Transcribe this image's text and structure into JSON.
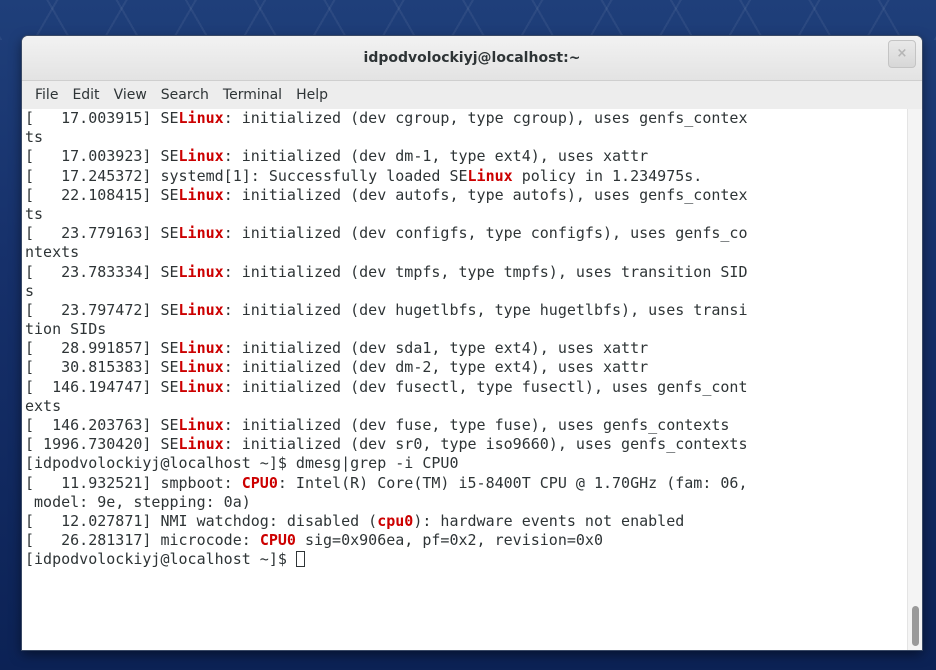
{
  "window": {
    "title": "idpodvolockiyj@localhost:~",
    "close_label": "×"
  },
  "menu": [
    "File",
    "Edit",
    "View",
    "Search",
    "Terminal",
    "Help"
  ],
  "terminal": {
    "lines": [
      [
        {
          "t": "[   17.003915] SE"
        },
        {
          "t": "Linux",
          "hl": true
        },
        {
          "t": ": initialized (dev cgroup, type cgroup), uses genfs_contex"
        }
      ],
      [
        {
          "t": "ts"
        }
      ],
      [
        {
          "t": "[   17.003923] SE"
        },
        {
          "t": "Linux",
          "hl": true
        },
        {
          "t": ": initialized (dev dm-1, type ext4), uses xattr"
        }
      ],
      [
        {
          "t": "[   17.245372] systemd[1]: Successfully loaded SE"
        },
        {
          "t": "Linux",
          "hl": true
        },
        {
          "t": " policy in 1.234975s."
        }
      ],
      [
        {
          "t": "[   22.108415] SE"
        },
        {
          "t": "Linux",
          "hl": true
        },
        {
          "t": ": initialized (dev autofs, type autofs), uses genfs_contex"
        }
      ],
      [
        {
          "t": "ts"
        }
      ],
      [
        {
          "t": "[   23.779163] SE"
        },
        {
          "t": "Linux",
          "hl": true
        },
        {
          "t": ": initialized (dev configfs, type configfs), uses genfs_co"
        }
      ],
      [
        {
          "t": "ntexts"
        }
      ],
      [
        {
          "t": "[   23.783334] SE"
        },
        {
          "t": "Linux",
          "hl": true
        },
        {
          "t": ": initialized (dev tmpfs, type tmpfs), uses transition SID"
        }
      ],
      [
        {
          "t": "s"
        }
      ],
      [
        {
          "t": "[   23.797472] SE"
        },
        {
          "t": "Linux",
          "hl": true
        },
        {
          "t": ": initialized (dev hugetlbfs, type hugetlbfs), uses transi"
        }
      ],
      [
        {
          "t": "tion SIDs"
        }
      ],
      [
        {
          "t": "[   28.991857] SE"
        },
        {
          "t": "Linux",
          "hl": true
        },
        {
          "t": ": initialized (dev sda1, type ext4), uses xattr"
        }
      ],
      [
        {
          "t": "[   30.815383] SE"
        },
        {
          "t": "Linux",
          "hl": true
        },
        {
          "t": ": initialized (dev dm-2, type ext4), uses xattr"
        }
      ],
      [
        {
          "t": "[  146.194747] SE"
        },
        {
          "t": "Linux",
          "hl": true
        },
        {
          "t": ": initialized (dev fusectl, type fusectl), uses genfs_cont"
        }
      ],
      [
        {
          "t": "exts"
        }
      ],
      [
        {
          "t": "[  146.203763] SE"
        },
        {
          "t": "Linux",
          "hl": true
        },
        {
          "t": ": initialized (dev fuse, type fuse), uses genfs_contexts"
        }
      ],
      [
        {
          "t": "[ 1996.730420] SE"
        },
        {
          "t": "Linux",
          "hl": true
        },
        {
          "t": ": initialized (dev sr0, type iso9660), uses genfs_contexts"
        }
      ],
      [
        {
          "t": "[idpodvolockiyj@localhost ~]$ dmesg|grep -i CPU0"
        }
      ],
      [
        {
          "t": "[   11.932521] smpboot: "
        },
        {
          "t": "CPU0",
          "hl": true
        },
        {
          "t": ": Intel(R) Core(TM) i5-8400T CPU @ 1.70GHz (fam: 06,"
        }
      ],
      [
        {
          "t": " model: 9e, stepping: 0a)"
        }
      ],
      [
        {
          "t": "[   12.027871] NMI watchdog: disabled ("
        },
        {
          "t": "cpu0",
          "hl": true
        },
        {
          "t": "): hardware events not enabled"
        }
      ],
      [
        {
          "t": "[   26.281317] microcode: "
        },
        {
          "t": "CPU0",
          "hl": true
        },
        {
          "t": " sig=0x906ea, pf=0x2, revision=0x0"
        }
      ]
    ],
    "prompt": "[idpodvolockiyj@localhost ~]$ ",
    "highlight_color": "#cc0000"
  }
}
